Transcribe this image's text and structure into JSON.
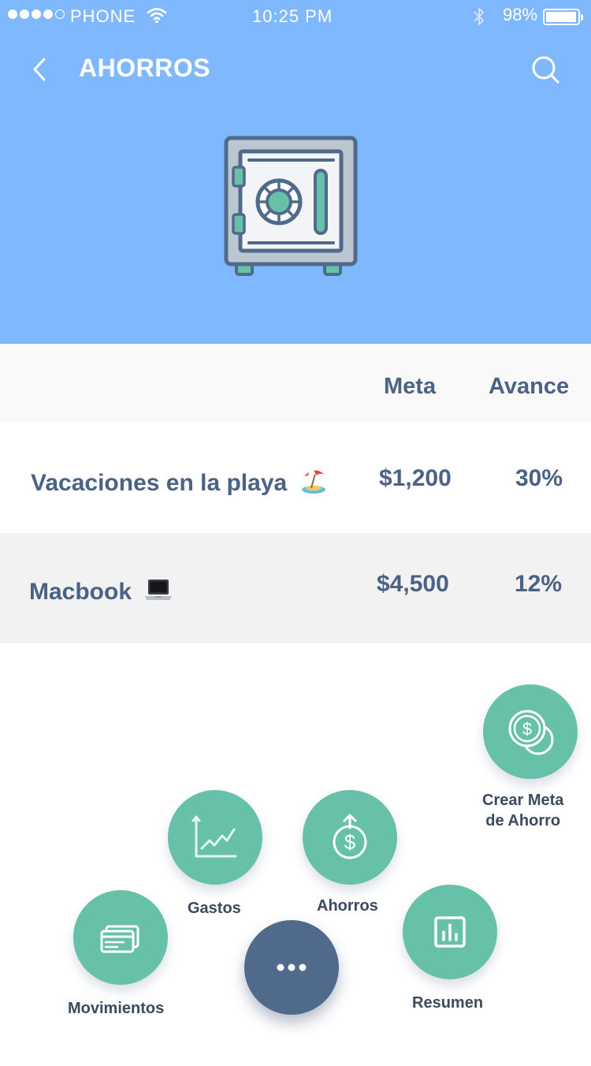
{
  "status_bar": {
    "carrier": "PHONE",
    "time": "10:25 PM",
    "battery": "98%",
    "battery_level": 0.98
  },
  "header": {
    "title": "AHORROS",
    "back_icon": "chevron-left-icon",
    "search_icon": "search-icon",
    "illustration": "safe-icon"
  },
  "table": {
    "columns": [
      "Meta",
      "Avance"
    ],
    "rows": [
      {
        "name": "Vacaciones en la playa",
        "emoji": "beach-umbrella-icon",
        "meta": "$1,200",
        "avance": "30%"
      },
      {
        "name": "Macbook",
        "emoji": "laptop-icon",
        "meta": "$4,500",
        "avance": "12%"
      }
    ]
  },
  "menu": {
    "create_goal": "Crear Meta\nde Ahorro",
    "expenses": "Gastos",
    "savings": "Ahorros",
    "movements": "Movimientos",
    "summary": "Resumen",
    "more_icon": "more-horizontal-icon"
  },
  "colors": {
    "header_bg": "#7fb8fc",
    "accent": "#67c1a9",
    "text": "#4a6285",
    "main_fab": "#4f6a8b"
  }
}
